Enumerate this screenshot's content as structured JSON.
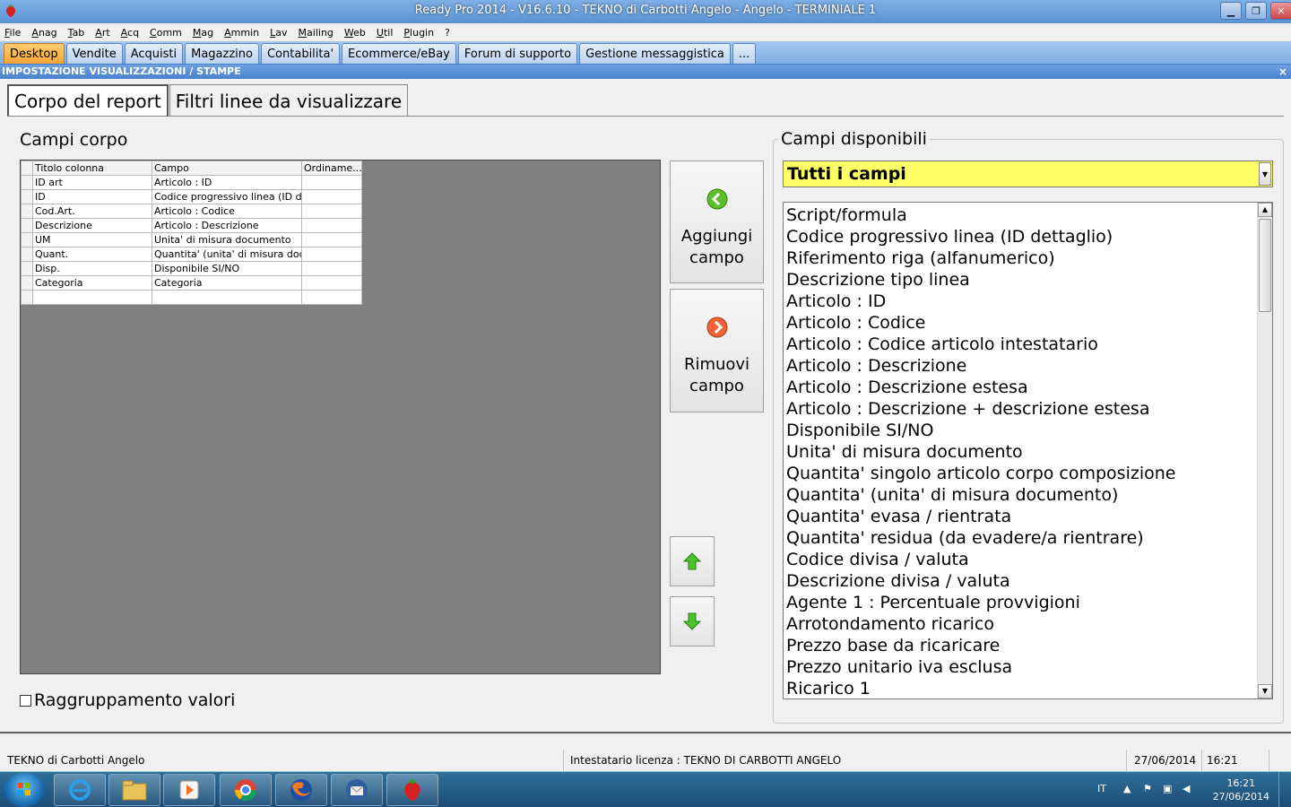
{
  "window": {
    "title": "Ready Pro 2014 - V16.6.10 - TEKNO di Carbotti Angelo - Angelo - TERMINIALE 1"
  },
  "menu": [
    "File",
    "Anag",
    "Tab",
    "Art",
    "Acq",
    "Comm",
    "Mag",
    "Ammin",
    "Lav",
    "Mailing",
    "Web",
    "Util",
    "Plugin",
    "?"
  ],
  "modules": {
    "tabs": [
      "Desktop",
      "Vendite",
      "Acquisti",
      "Magazzino",
      "Contabilita'",
      "Ecommerce/eBay",
      "Forum di supporto",
      "Gestione messaggistica",
      "..."
    ],
    "active": 0
  },
  "panel": {
    "title": "IMPOSTAZIONE VISUALIZZAZIONI / STAMPE",
    "close": "×"
  },
  "subtabs": [
    "Corpo del report",
    "Filtri linee da visualizzare"
  ],
  "left": {
    "label": "Campi corpo",
    "columns": [
      "Titolo colonna",
      "Campo",
      "Ordiname..."
    ],
    "rows": [
      [
        "ID art",
        "Articolo : ID",
        ""
      ],
      [
        "ID",
        "Codice progressivo linea (ID de...",
        ""
      ],
      [
        "Cod.Art.",
        "Articolo : Codice",
        ""
      ],
      [
        "Descrizione",
        "Articolo : Descrizione",
        ""
      ],
      [
        "UM",
        "Unita' di misura documento",
        ""
      ],
      [
        "Quant.",
        "Quantita' (unita' di misura docu...",
        ""
      ],
      [
        "Disp.",
        "Disponibile SI/NO",
        ""
      ],
      [
        "Categoria",
        "Categoria",
        ""
      ],
      [
        "",
        "",
        ""
      ]
    ],
    "grouping_label": "Raggruppamento valori"
  },
  "buttons": {
    "add_line1": "Aggiungi",
    "add_line2": "campo",
    "remove_line1": "Rimuovi",
    "remove_line2": "campo"
  },
  "right": {
    "label": "Campi disponibili",
    "combo_value": "Tutti i campi",
    "fields": [
      "Script/formula",
      "Codice progressivo linea (ID dettaglio)",
      "Riferimento riga (alfanumerico)",
      "Descrizione tipo linea",
      "Articolo : ID",
      "Articolo : Codice",
      "Articolo : Codice articolo intestatario",
      "Articolo : Descrizione",
      "Articolo : Descrizione estesa",
      "Articolo : Descrizione + descrizione estesa",
      "Disponibile SI/NO",
      "Unita' di misura documento",
      "Quantita' singolo articolo corpo composizione",
      "Quantita' (unita' di misura documento)",
      "Quantita' evasa / rientrata",
      "Quantita' residua (da evadere/a rientrare)",
      "Codice divisa / valuta",
      "Descrizione divisa / valuta",
      "Agente 1 : Percentuale provvigioni",
      "Arrotondamento ricarico",
      "Prezzo base da ricaricare",
      "Prezzo unitario iva esclusa",
      "Ricarico 1"
    ]
  },
  "status": {
    "company": "TEKNO di Carbotti Angelo",
    "license": "Intestatario licenza : TEKNO DI CARBOTTI ANGELO",
    "date": "27/06/2014",
    "time": "16:21"
  },
  "taskbar": {
    "lang": "IT",
    "clock_time": "16:21",
    "clock_date": "27/06/2014"
  },
  "colors": {
    "active_module_tab": "#f6a437",
    "combo_bg": "#ffff66",
    "title_bar": "#5c92d3"
  }
}
